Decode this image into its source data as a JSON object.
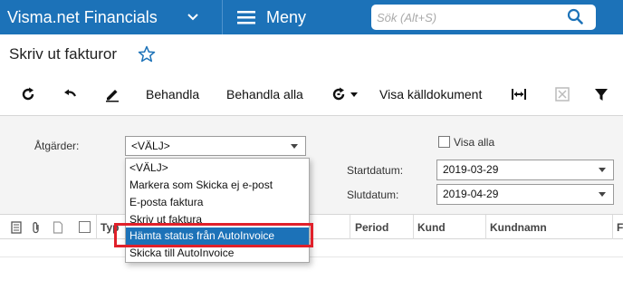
{
  "app": {
    "title": "Visma.net Financials",
    "menu_label": "Meny"
  },
  "search": {
    "placeholder": "Sök (Alt+S)"
  },
  "page": {
    "title": "Skriv ut fakturor"
  },
  "toolbar": {
    "process_label": "Behandla",
    "process_all_label": "Behandla alla",
    "view_source_label": "Visa källdokument"
  },
  "filters": {
    "actions_label": "Åtgärder:",
    "actions_value": "<VÄLJ>",
    "show_all_label": "Visa alla",
    "start_date_label": "Startdatum:",
    "start_date_value": "2019-03-29",
    "end_date_label": "Slutdatum:",
    "end_date_value": "2019-04-29"
  },
  "dropdown": {
    "options": [
      "<VÄLJ>",
      "Markera som Skicka ej e-post",
      "E-posta faktura",
      "Skriv ut faktura",
      "Hämta status från AutoInvoice",
      "Skicka till AutoInvoice"
    ],
    "selected_index": 4
  },
  "grid": {
    "columns": [
      "Typ",
      "Period",
      "Kund",
      "Kundnamn",
      "F"
    ]
  },
  "colors": {
    "header_bg": "#1c72b8",
    "selected_option": "#1c72b8",
    "annotation_box": "#e0202a"
  },
  "icons": [
    "chevron-down-icon",
    "hamburger-icon",
    "search-icon",
    "star-icon",
    "refresh-icon",
    "undo-icon",
    "edit-icon",
    "sync-icon",
    "fit-width-icon",
    "export-excel-icon",
    "filter-icon",
    "notes-icon",
    "attachment-icon",
    "document-icon",
    "checkbox"
  ]
}
